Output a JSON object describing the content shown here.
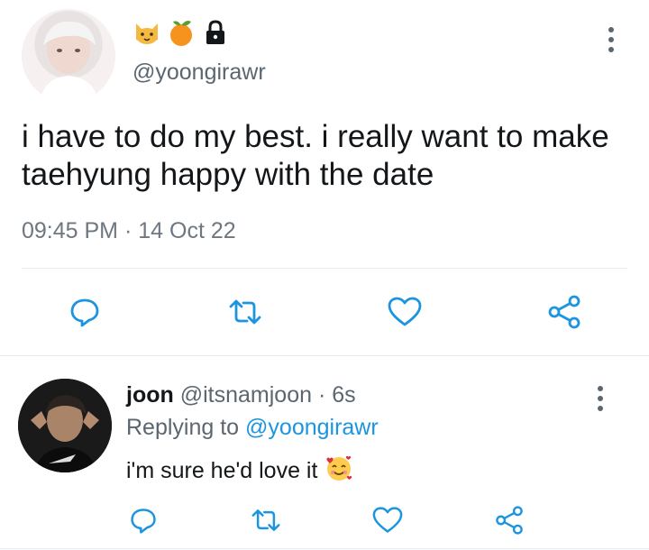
{
  "colors": {
    "text": "#14171a",
    "secondary": "#5b6670",
    "link": "#1b95e0",
    "icon": "#1b95e0",
    "divider": "#e6ecf0"
  },
  "main_tweet": {
    "emoji_icons": [
      "cat-face-icon",
      "tangerine-icon",
      "lock-icon"
    ],
    "handle": "@yoongirawr",
    "text": "i have to do my best. i really want to make taehyung happy with the date",
    "time": "09:45 PM",
    "separator": "·",
    "date": "14 Oct 22",
    "actions": [
      "reply-icon",
      "retweet-icon",
      "like-icon",
      "share-icon"
    ]
  },
  "reply": {
    "name": "joon",
    "handle": "@itsnamjoon",
    "separator": "·",
    "age": "6s",
    "replying_prefix": "Replying to",
    "replying_to": "@yoongirawr",
    "text": "i'm sure he'd love it",
    "emoji": "smiling-face-with-hearts-icon",
    "actions": [
      "reply-icon",
      "retweet-icon",
      "like-icon",
      "share-icon"
    ]
  }
}
